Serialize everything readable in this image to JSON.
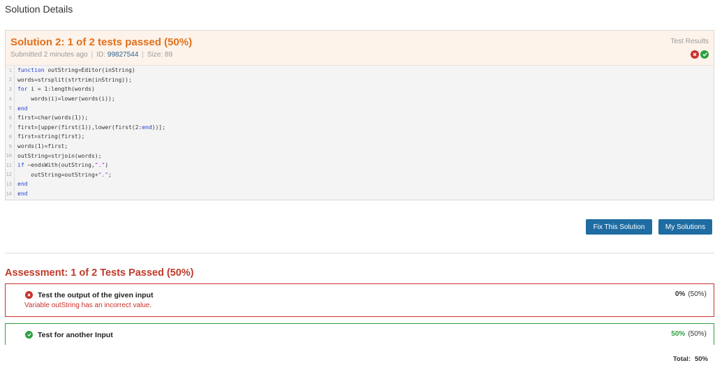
{
  "page": {
    "heading": "Solution Details"
  },
  "solution": {
    "title": "Solution 2: 1 of 2 tests passed (50%)",
    "submitted": "Submitted 2 minutes ago",
    "id_label": "ID:",
    "id_value": "99827544",
    "size": "Size: 89",
    "test_results_label": "Test Results",
    "result_icons": [
      "fail-icon",
      "pass-icon"
    ],
    "colors": {
      "title": "#e0701c",
      "header_bg": "#fdf3ea",
      "fail": "#c9302c",
      "pass": "#2ea043"
    }
  },
  "code": {
    "lines": [
      "function outString=Editor(inString)",
      "words=strsplit(strtrim(inString));",
      "for i = 1:length(words)",
      "    words(i)=lower(words(i));",
      "end",
      "first=char(words(1));",
      "first=[upper(first(1)),lower(first(2:end))];",
      "first=string(first);",
      "words(1)=first;",
      "outString=strjoin(words);",
      "if ~endsWith(outString,\".\")",
      "    outString=outString+\".\";",
      "end",
      "end"
    ]
  },
  "buttons": {
    "fix": "Fix This Solution",
    "my": "My Solutions",
    "color": "#1f6ca3"
  },
  "assessment": {
    "title": "Assessment: 1 of 2 Tests Passed (50%)",
    "tests": [
      {
        "name": "Test the output of the given input",
        "message": "Variable outString has an incorrect value.",
        "score": "0%",
        "weight": "(50%)",
        "status": "fail"
      },
      {
        "name": "Test for another Input",
        "message": "",
        "score": "50%",
        "weight": "(50%)",
        "status": "pass"
      }
    ],
    "total_label": "Total:",
    "total_value": "50%"
  }
}
